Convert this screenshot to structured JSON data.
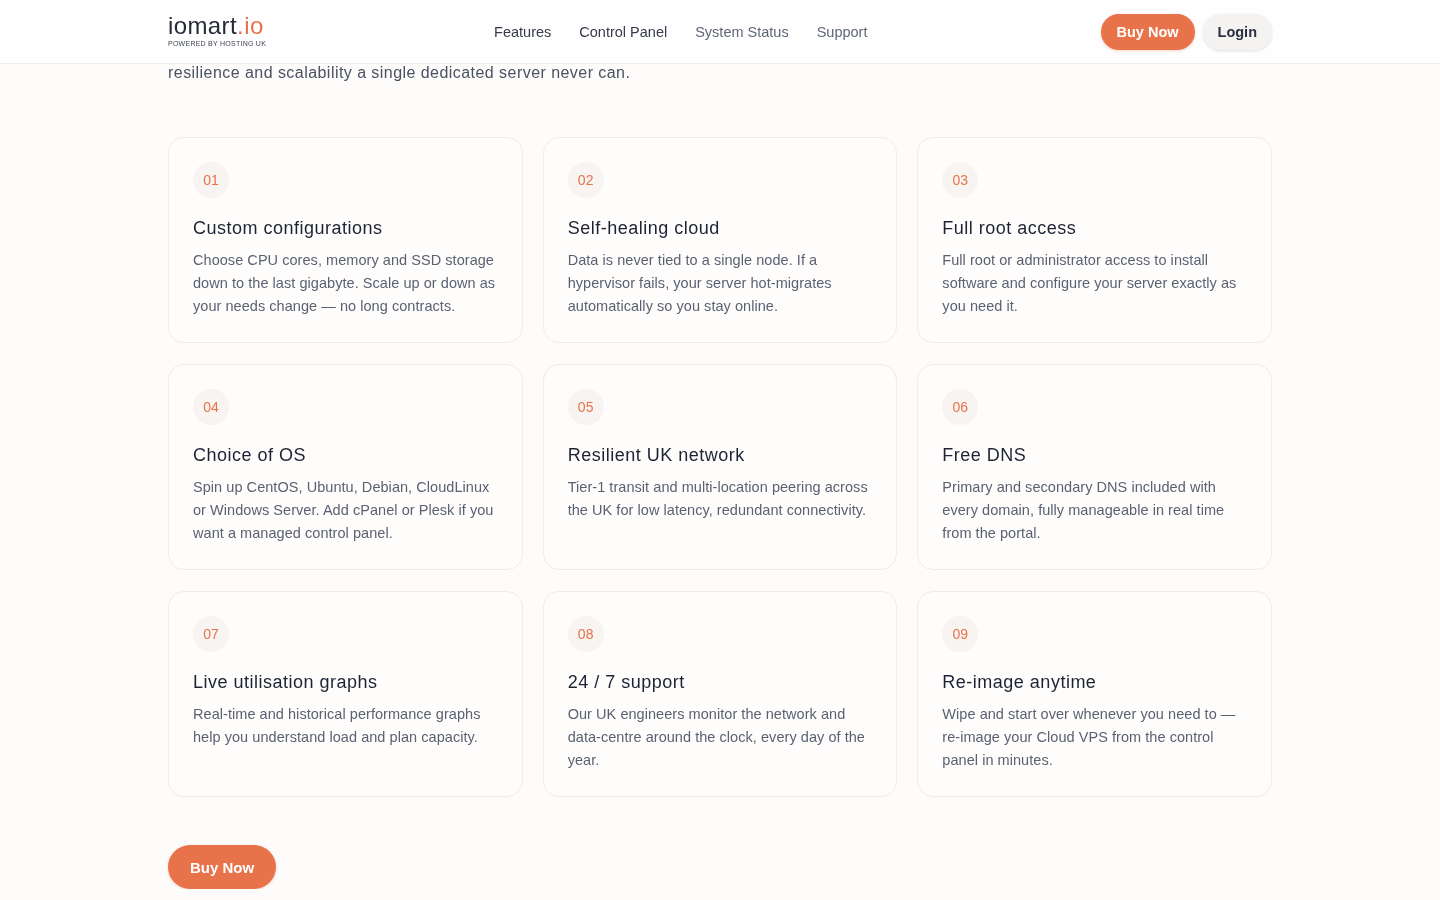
{
  "header": {
    "logo": {
      "wordmark": "iomart",
      "wordmark_accent": ".io",
      "tagline": "POWERED BY HOSTING UK"
    },
    "nav": [
      {
        "label": "Features",
        "dimmed": false
      },
      {
        "label": "Control Panel",
        "dimmed": false
      },
      {
        "label": "System Status",
        "dimmed": true
      },
      {
        "label": "Support",
        "dimmed": true
      }
    ],
    "actions": [
      {
        "label": "Buy Now",
        "kind": "primary"
      },
      {
        "label": "Login",
        "kind": "secondary"
      }
    ]
  },
  "intro": "resilience and scalability a single dedicated server never can.",
  "features": [
    {
      "number": "01",
      "title": "Custom configurations",
      "description": "Choose CPU cores, memory and SSD storage down to the last gigabyte. Scale up or down as your needs change — no long contracts."
    },
    {
      "number": "02",
      "title": "Self-healing cloud",
      "description": "Data is never tied to a single node. If a hypervisor fails, your server hot-migrates automatically so you stay online."
    },
    {
      "number": "03",
      "title": "Full root access",
      "description": "Full root or administrator access to install software and configure your server exactly as you need it."
    },
    {
      "number": "04",
      "title": "Choice of OS",
      "description": "Spin up CentOS, Ubuntu, Debian, CloudLinux or Windows Server. Add cPanel or Plesk if you want a managed control panel."
    },
    {
      "number": "05",
      "title": "Resilient UK network",
      "description": "Tier-1 transit and multi-location peering across the UK for low latency, redundant connectivity."
    },
    {
      "number": "06",
      "title": "Free DNS",
      "description": "Primary and secondary DNS included with every domain, fully manageable in real time from the portal."
    },
    {
      "number": "07",
      "title": "Live utilisation graphs",
      "description": "Real-time and historical performance graphs help you understand load and plan capacity."
    },
    {
      "number": "08",
      "title": "24 / 7 support",
      "description": "Our UK engineers monitor the network and data-centre around the clock, every day of the year."
    },
    {
      "number": "09",
      "title": "Re-image anytime",
      "description": "Wipe and start over whenever you need to — re-image your Cloud VPS from the control panel in minutes."
    }
  ],
  "cta": {
    "label": "Buy Now",
    "kind": "primary"
  }
}
